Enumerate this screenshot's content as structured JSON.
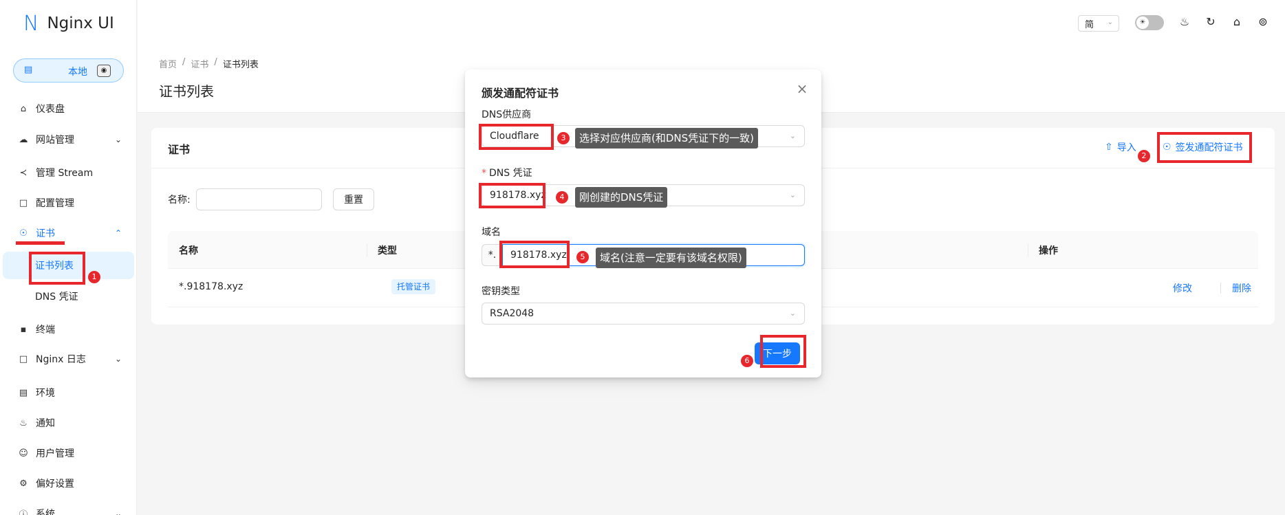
{
  "app": {
    "logo_mark": "N",
    "name": "Nginx UI"
  },
  "env": {
    "label": "本地"
  },
  "menu": {
    "dashboard": "仪表盘",
    "sites": "网站管理",
    "stream": "管理 Stream",
    "config": "配置管理",
    "certs": "证书",
    "cert_list": "证书列表",
    "dns_credentials": "DNS 凭证",
    "terminal": "终端",
    "nginx_log": "Nginx 日志",
    "environment": "环境",
    "notification": "通知",
    "users": "用户管理",
    "preferences": "偏好设置",
    "system": "系统"
  },
  "header": {
    "lang": "简"
  },
  "breadcrumb": [
    "首页",
    "证书",
    "证书列表"
  ],
  "page_title": "证书列表",
  "card": {
    "title": "证书",
    "import": "导入",
    "issue_wildcard": "签发通配符证书",
    "filter_label": "名称:",
    "reset": "重置"
  },
  "table": {
    "columns": [
      "名称",
      "类型",
      "操作"
    ],
    "rows": [
      {
        "name": "*.918178.xyz",
        "type": "托管证书",
        "edit": "修改",
        "delete": "删除"
      }
    ]
  },
  "modal": {
    "title": "颁发通配符证书",
    "close_icon": "×",
    "dns_provider_label": "DNS供应商",
    "dns_provider_value": "Cloudflare",
    "dns_credential_required": "*",
    "dns_credential_label": "DNS 凭证",
    "dns_credential_value": "918178.xyz",
    "domain_label": "域名",
    "domain_prefix": "*.",
    "domain_value": "918178.xyz",
    "key_type_label": "密钥类型",
    "key_type_value": "RSA2048",
    "next": "下一步"
  },
  "annotations": {
    "badges": [
      "1",
      "2",
      "3",
      "4",
      "5",
      "6"
    ],
    "callouts": {
      "c3": "选择对应供应商(和DNS凭证下的一致)",
      "c4": "刚创建的DNS凭证",
      "c5": "域名(注意一定要有该域名权限)"
    },
    "color": "#e8272d"
  },
  "colors": {
    "accent": "#1677ff",
    "annotation": "#e8272d"
  }
}
